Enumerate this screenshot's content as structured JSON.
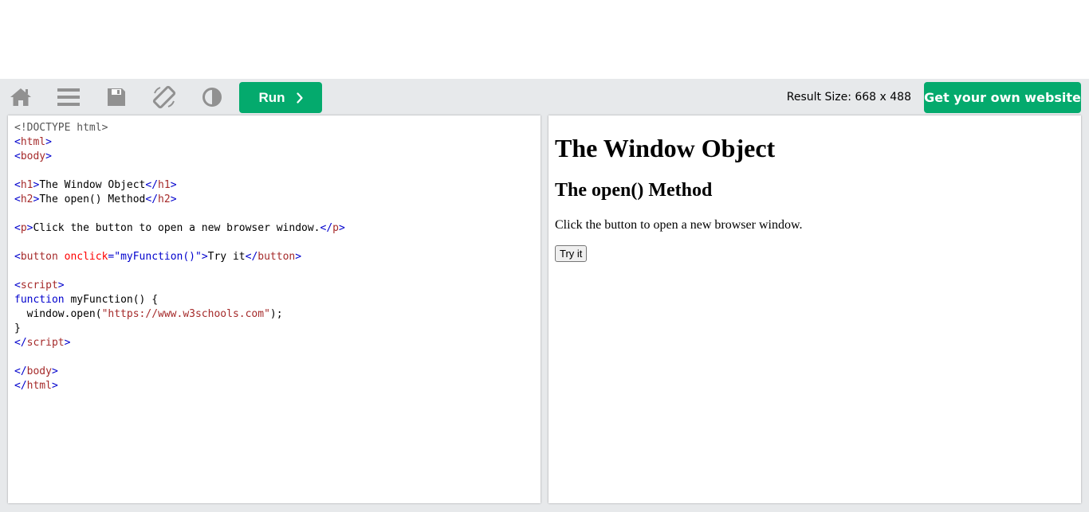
{
  "toolbar": {
    "icons": [
      "home-icon",
      "menu-icon",
      "save-icon",
      "rotate-icon",
      "contrast-icon"
    ],
    "run_label": "Run",
    "result_size": "Result Size: 668 x 488",
    "get_website_label": "Get your own website",
    "colors": {
      "accent": "#04aa6d",
      "icon": "#919191",
      "workspace_bg": "#e7e9eb"
    }
  },
  "code": {
    "l1_doctype": "<!DOCTYPE html>",
    "l2_open": "<",
    "l2_name": "html",
    "l2_close": ">",
    "l3_open": "<",
    "l3_name": "body",
    "l3_close": ">",
    "l5_open": "<",
    "l5_name": "h1",
    "l5_gt": ">",
    "l5_text": "The Window Object",
    "l5_end_open": "</",
    "l5_end_name": "h1",
    "l5_end_gt": ">",
    "l6_open": "<",
    "l6_name": "h2",
    "l6_gt": ">",
    "l6_text": "The open() Method",
    "l6_end_open": "</",
    "l6_end_name": "h2",
    "l6_end_gt": ">",
    "l8_open": "<",
    "l8_name": "p",
    "l8_gt": ">",
    "l8_text": "Click the button to open a new browser window.",
    "l8_end_open": "</",
    "l8_end_name": "p",
    "l8_end_gt": ">",
    "l10_open": "<",
    "l10_name": "button",
    "l10_space": " ",
    "l10_attr": "onclick",
    "l10_eq": "=",
    "l10_val": "\"myFunction()\"",
    "l10_gt": ">",
    "l10_text": "Try it",
    "l10_end_open": "</",
    "l10_end_name": "button",
    "l10_end_gt": ">",
    "l12_open": "<",
    "l12_name": "script",
    "l12_gt": ">",
    "l13_kw": "function",
    "l13_rest": " myFunction() {",
    "l14_pre": "  window.open(",
    "l14_str": "\"https://www.w3schools.com\"",
    "l14_post": ");",
    "l15": "}",
    "l16_open": "</",
    "l16_name": "script",
    "l16_gt": ">",
    "l18_open": "</",
    "l18_name": "body",
    "l18_gt": ">",
    "l19_open": "</",
    "l19_name": "html",
    "l19_gt": ">"
  },
  "result": {
    "h1": "The Window Object",
    "h2": "The open() Method",
    "p": "Click the button to open a new browser window.",
    "button": "Try it"
  }
}
